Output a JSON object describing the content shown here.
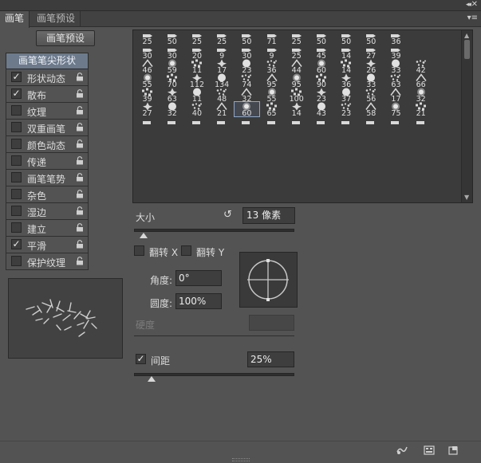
{
  "window": {
    "collapse_glyph": "◂◂",
    "close_glyph": "✕"
  },
  "tabs": [
    {
      "label": "画笔",
      "active": true
    },
    {
      "label": "画笔预设",
      "active": false
    }
  ],
  "tab_menu_glyph": "▾≡",
  "preset_button": "画笔预设",
  "options_header": "画笔笔尖形状",
  "options": [
    {
      "label": "形状动态",
      "checked": true
    },
    {
      "label": "散布",
      "checked": true
    },
    {
      "label": "纹理",
      "checked": false
    },
    {
      "label": "双重画笔",
      "checked": false
    },
    {
      "label": "颜色动态",
      "checked": false
    },
    {
      "label": "传递",
      "checked": false
    },
    {
      "label": "画笔笔势",
      "checked": false
    },
    {
      "label": "杂色",
      "checked": false
    },
    {
      "label": "湿边",
      "checked": false
    },
    {
      "label": "建立",
      "checked": false
    },
    {
      "label": "平滑",
      "checked": true
    },
    {
      "label": "保护纹理",
      "checked": false
    }
  ],
  "brush_grid": {
    "selected_index": 62,
    "rows": [
      [
        "25",
        "50",
        "25",
        "25",
        "50",
        "71",
        "25",
        "50",
        "50",
        "50",
        "36"
      ],
      [
        "30",
        "30",
        "20",
        "9",
        "30",
        "9",
        "25",
        "45",
        "14",
        "27",
        "39"
      ],
      [
        "46",
        "59",
        "11",
        "17",
        "23",
        "36",
        "44",
        "60",
        "14",
        "26",
        "33",
        "42"
      ],
      [
        "55",
        "70",
        "112",
        "134",
        "74",
        "95",
        "95",
        "90",
        "36",
        "33",
        "63",
        "66"
      ],
      [
        "39",
        "63",
        "11",
        "48",
        "32",
        "55",
        "100",
        "23",
        "37",
        "56",
        "17",
        "32"
      ],
      [
        "27",
        "32",
        "40",
        "21",
        "60",
        "65",
        "14",
        "43",
        "23",
        "58",
        "75",
        "21"
      ],
      [
        "",
        "",
        "",
        "",
        "",
        "",
        "",
        "",
        "",
        "",
        "",
        ""
      ]
    ]
  },
  "size": {
    "label": "大小",
    "value": "13 像素",
    "reset_glyph": "↺",
    "slider_fraction": 0.06
  },
  "flip": {
    "x_label": "翻转 X",
    "y_label": "翻转 Y",
    "x_checked": false,
    "y_checked": false
  },
  "angle": {
    "label": "角度:",
    "value": "0°"
  },
  "roundness": {
    "label": "圆度:",
    "value": "100%"
  },
  "hardness": {
    "label": "硬度",
    "value": ""
  },
  "spacing": {
    "label": "间距",
    "value": "25%",
    "checked": true,
    "slider_fraction": 0.11
  },
  "colors": {
    "panel_bg": "#535353",
    "header_selected": "#6d7a8c",
    "field_bg": "#3e3e3e"
  },
  "bottom_icons": [
    "toggle-brush-panel-icon",
    "create-brush-icon",
    "new-preset-icon"
  ]
}
